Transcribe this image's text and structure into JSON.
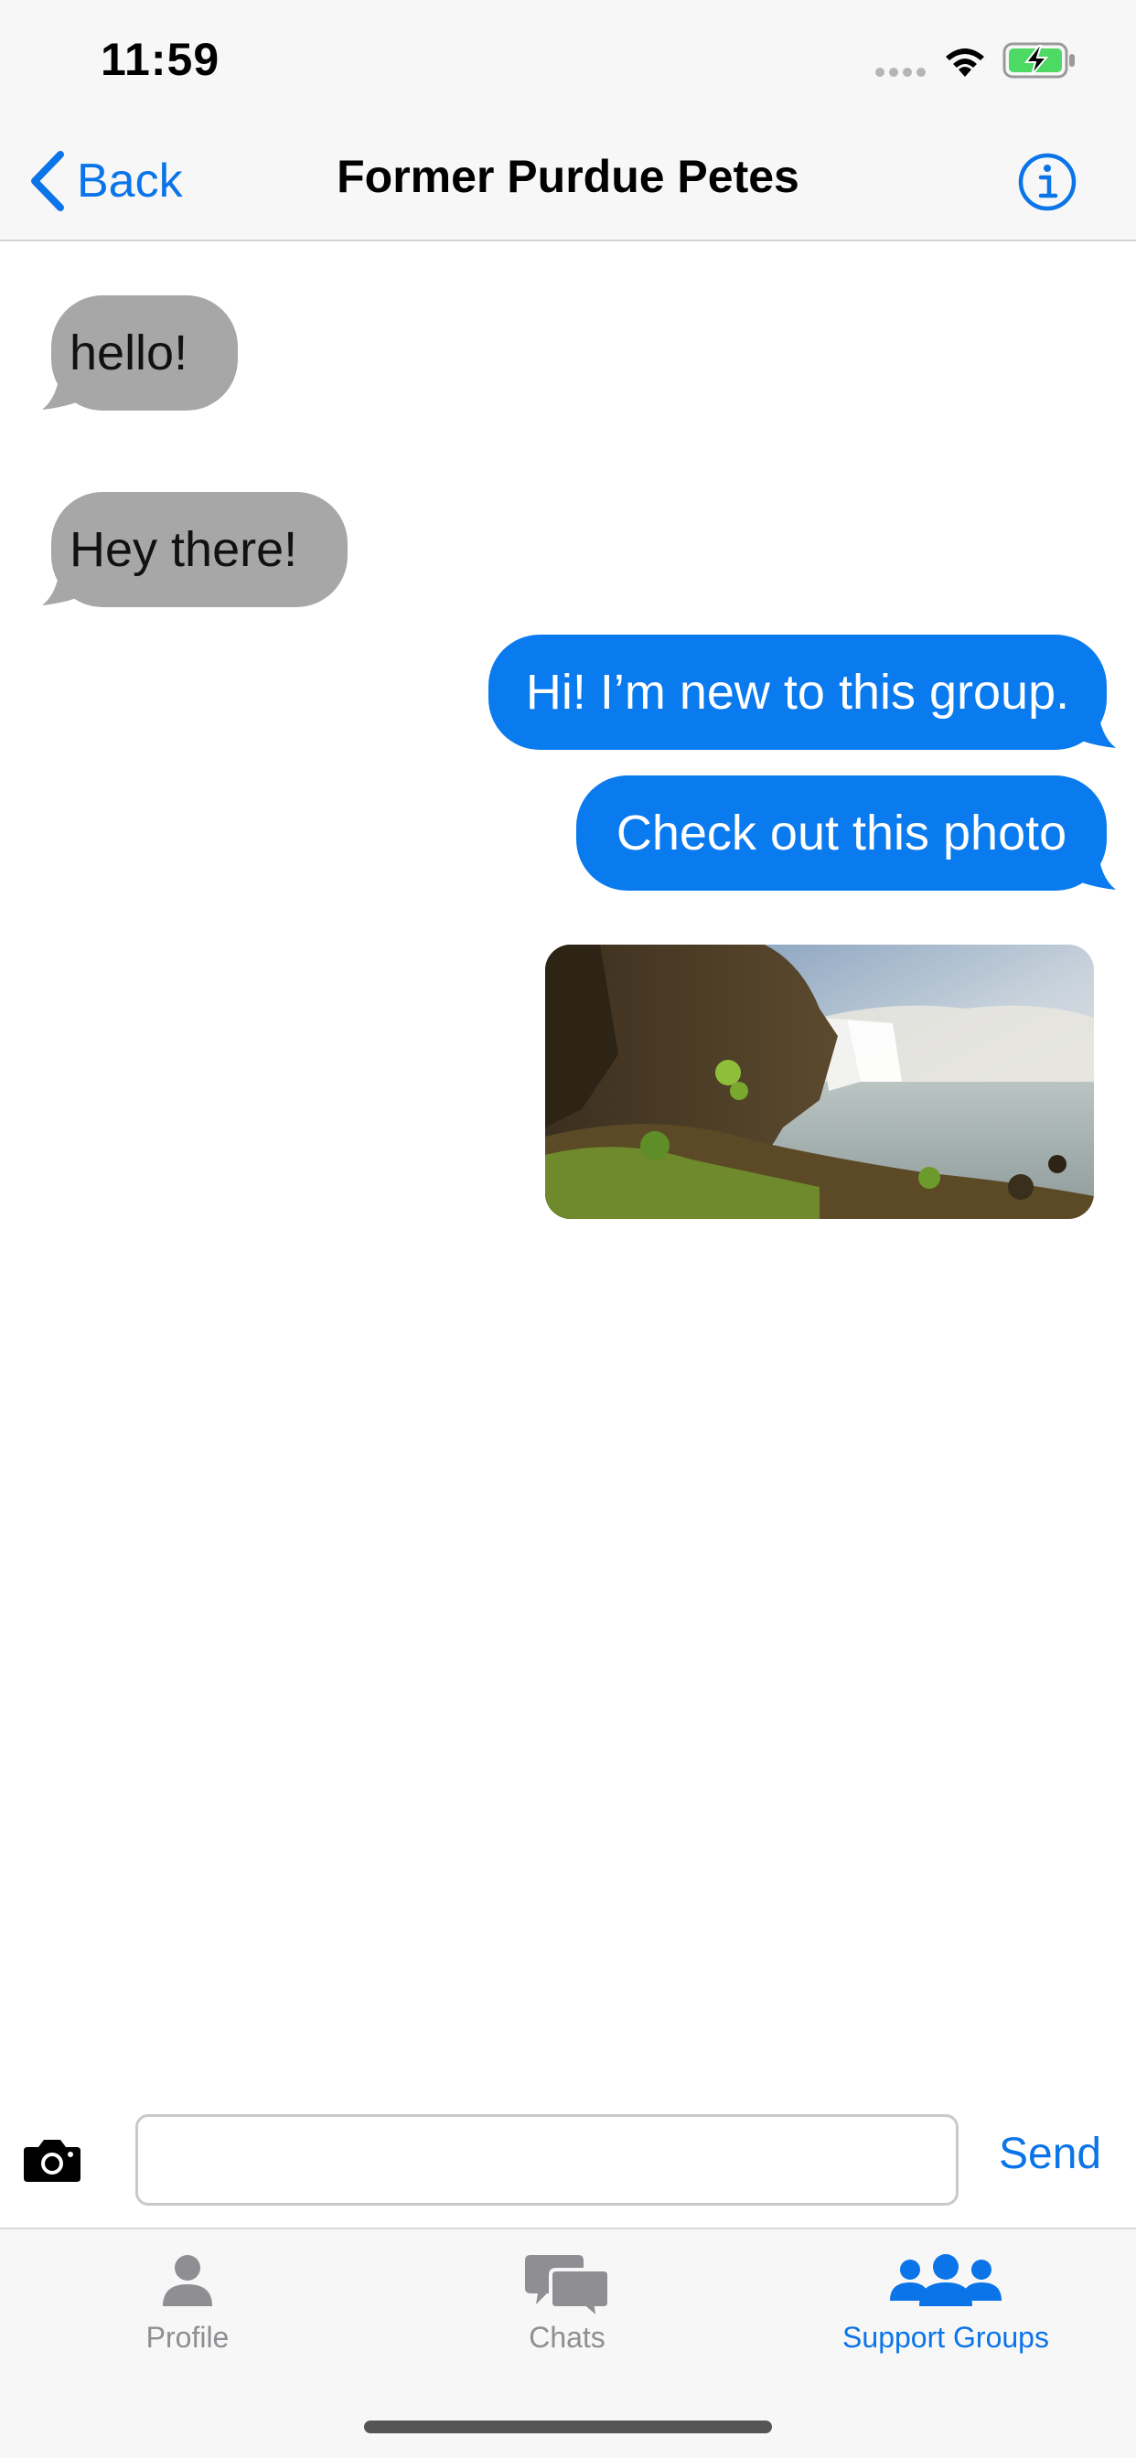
{
  "status_bar": {
    "time": "11:59",
    "icons": [
      "cellular-dots-icon",
      "wifi-icon",
      "battery-charging-icon"
    ],
    "battery_color": "#4cd964"
  },
  "nav": {
    "back_label": "Back",
    "title": "Former Purdue Petes",
    "info_icon": "info-circle-icon",
    "accent_color": "#0a74e8"
  },
  "messages": [
    {
      "direction": "incoming",
      "text": "hello!"
    },
    {
      "direction": "incoming",
      "text": "Hey there!"
    },
    {
      "direction": "outgoing",
      "text": "Hi! I’m new to this group."
    },
    {
      "direction": "outgoing",
      "text": "Check out this photo"
    },
    {
      "direction": "outgoing",
      "type": "image",
      "image": "waterfall-landscape-photo"
    }
  ],
  "colors": {
    "incoming_bubble": "#a7a7a7",
    "outgoing_bubble": "#0a7aef"
  },
  "composer": {
    "camera_icon": "camera-icon",
    "input_value": "",
    "input_placeholder": "",
    "send_label": "Send"
  },
  "tabs": [
    {
      "label": "Profile",
      "icon": "person-icon",
      "active": false
    },
    {
      "label": "Chats",
      "icon": "chat-bubbles-icon",
      "active": false
    },
    {
      "label": "Support Groups",
      "icon": "people-group-icon",
      "active": true
    }
  ]
}
